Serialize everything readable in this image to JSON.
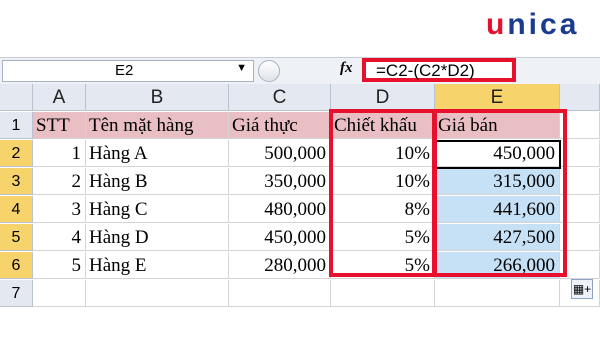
{
  "logo": {
    "letters": [
      "u",
      "n",
      "i",
      "c",
      "a"
    ],
    "colors": [
      "#e8112d",
      "#1a3b8f",
      "#1a3b8f",
      "#1a3b8f",
      "#1a3b8f"
    ]
  },
  "formula_bar": {
    "name_box": "E2",
    "fx_label": "fx",
    "formula": "=C2-(C2*D2)"
  },
  "columns": [
    "A",
    "B",
    "C",
    "D",
    "E"
  ],
  "rows": [
    "1",
    "2",
    "3",
    "4",
    "5",
    "6",
    "7"
  ],
  "headers": [
    "STT",
    "Tên mặt hàng",
    "Giá thực",
    "Chiết khấu",
    "Giá bán"
  ],
  "data": [
    [
      "1",
      "Hàng A",
      "500,000",
      "10%",
      "450,000"
    ],
    [
      "2",
      "Hàng B",
      "350,000",
      "10%",
      "315,000"
    ],
    [
      "3",
      "Hàng C",
      "480,000",
      "8%",
      "441,600"
    ],
    [
      "4",
      "Hàng D",
      "450,000",
      "5%",
      "427,500"
    ],
    [
      "5",
      "Hàng E",
      "280,000",
      "5%",
      "266,000"
    ]
  ],
  "colors": {
    "highlight_red": "#e8112d",
    "header_fill": "#e9bfc3",
    "result_fill": "#c6e0f6"
  }
}
